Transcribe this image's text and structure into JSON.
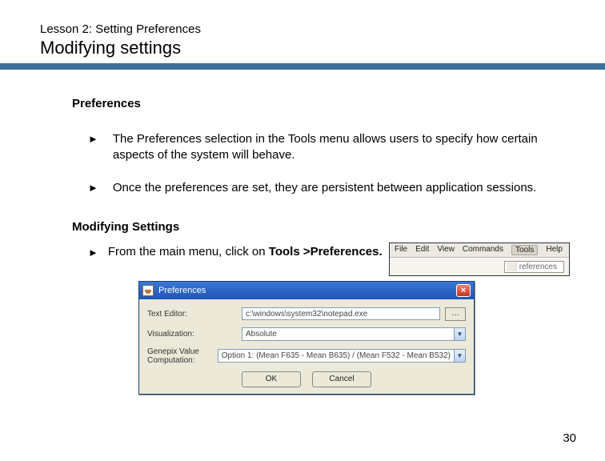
{
  "header": {
    "lesson": "Lesson 2: Setting Preferences",
    "title": "Modifying settings"
  },
  "sections": {
    "prefs_heading": "Preferences",
    "bullet1": "The Preferences selection in the Tools menu allows users to specify how certain aspects of the system will behave.",
    "bullet2": "Once the preferences are set, they are persistent between application sessions.",
    "mod_heading": "Modifying Settings",
    "step_prefix": "From the main menu, click on ",
    "step_bold": "Tools >Preferences."
  },
  "menubar": {
    "items": [
      "File",
      "Edit",
      "View",
      "Commands",
      "Tools",
      "Help"
    ],
    "highlighted": "Tools",
    "submenu": "references"
  },
  "dialog": {
    "title": "Preferences",
    "rows": {
      "text_editor": {
        "label": "Text Editor:",
        "value": "c:\\windows\\system32\\notepad.exe",
        "browse": "…"
      },
      "visualization": {
        "label": "Visualization:",
        "value": "Absolute"
      },
      "genepix": {
        "label": "Genepix Value Computation:",
        "value": "Option 1: (Mean F635 - Mean B635) / (Mean F532 - Mean B532)"
      }
    },
    "buttons": {
      "ok": "OK",
      "cancel": "Cancel"
    }
  },
  "page_number": "30"
}
